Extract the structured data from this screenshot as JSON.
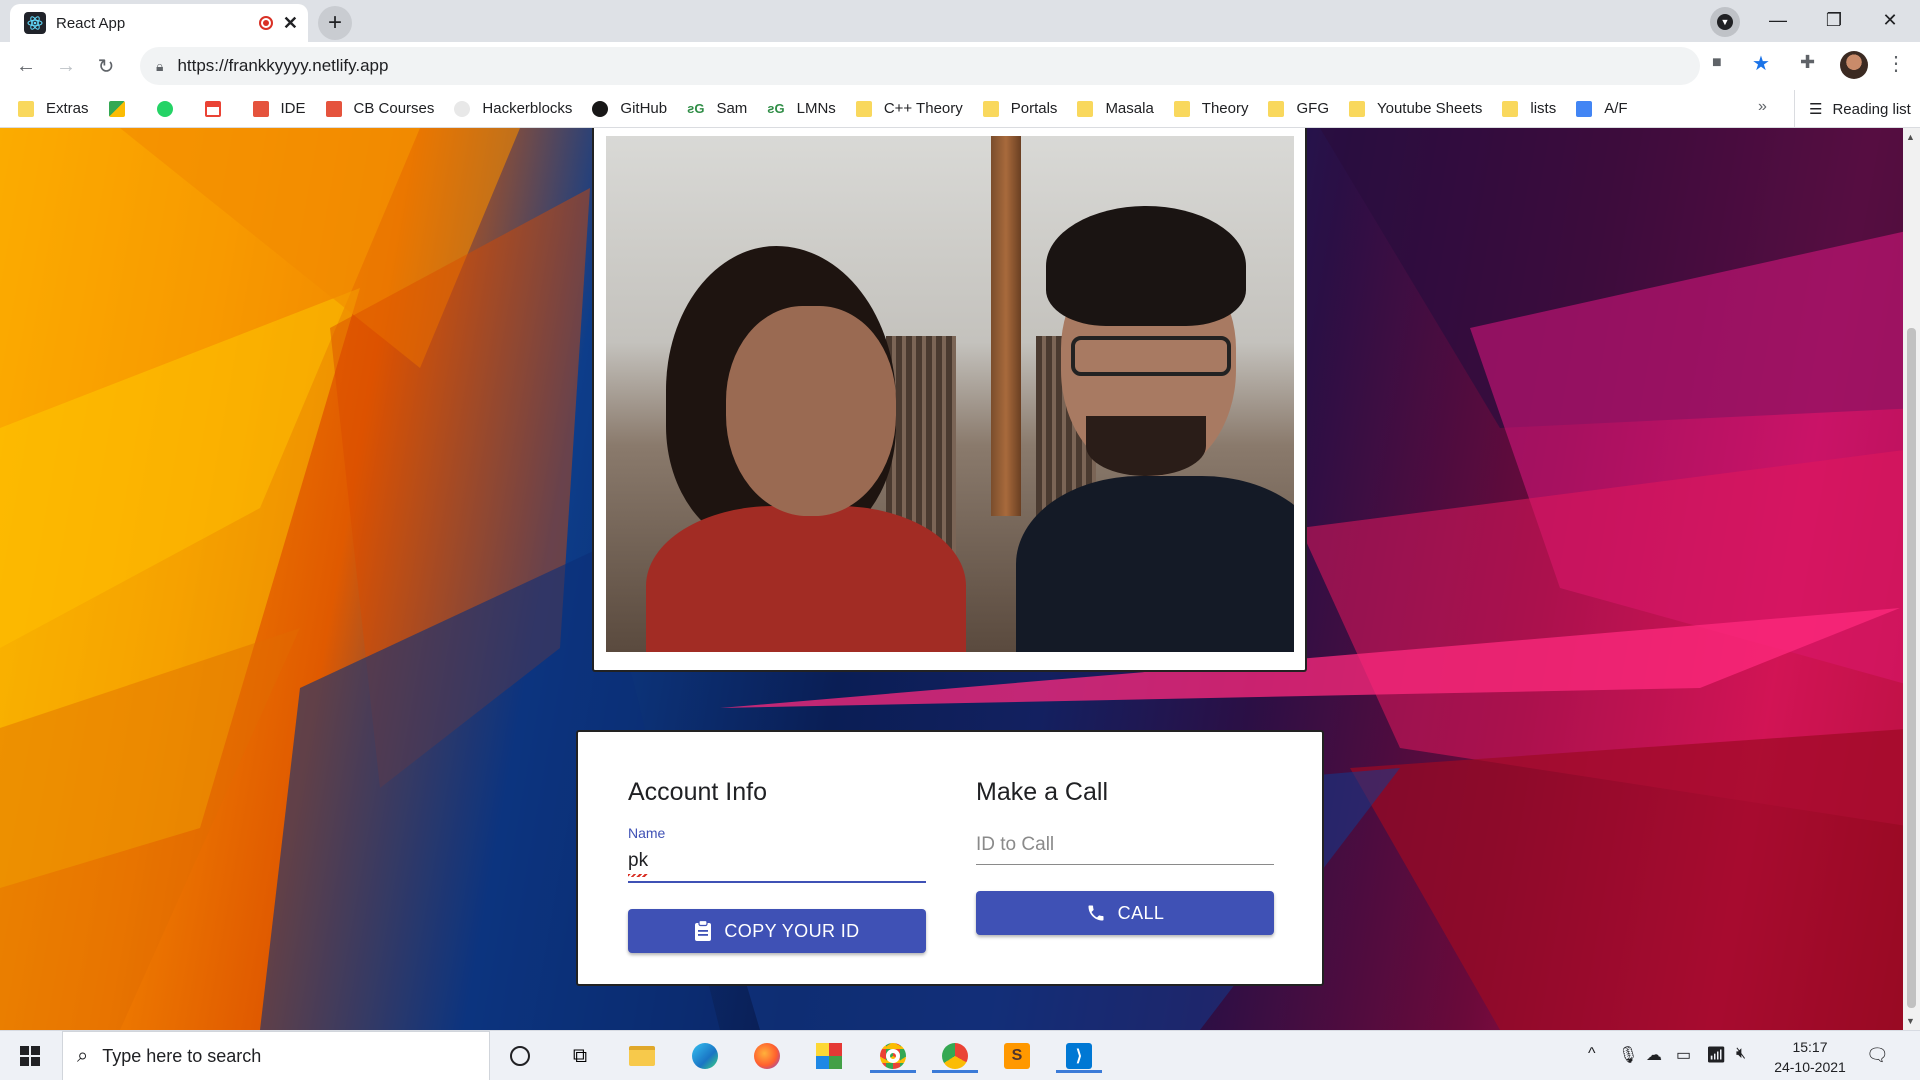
{
  "browser": {
    "tab_title": "React App",
    "url": "https://frankkyyyy.netlify.app",
    "bookmarks": [
      "Extras",
      "IDE",
      "CB Courses",
      "Hackerblocks",
      "GitHub",
      "Sam",
      "LMNs",
      "C++ Theory",
      "Portals",
      "Masala",
      "Theory",
      "GFG",
      "Youtube Sheets",
      "lists",
      "A/F"
    ],
    "reading_list": "Reading list"
  },
  "page": {
    "account": {
      "heading": "Account Info",
      "name_label": "Name",
      "name_value": "pk",
      "copy_button": "COPY YOUR ID"
    },
    "call": {
      "heading": "Make a Call",
      "id_placeholder": "ID to Call",
      "call_button": "CALL"
    }
  },
  "taskbar": {
    "search_placeholder": "Type here to search",
    "time": "15:17",
    "date": "24-10-2021"
  },
  "colors": {
    "primary": "#3f51b5",
    "record_red": "#d93025",
    "bookmark_star": "#1a73e8"
  }
}
